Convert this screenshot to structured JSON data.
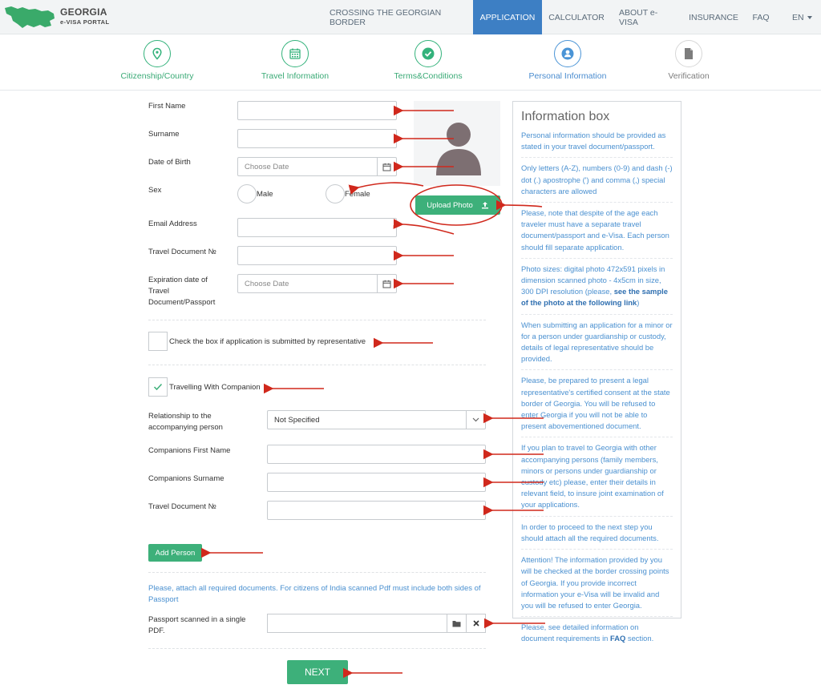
{
  "brand": {
    "title": "GEORGIA",
    "subtitle": "e-VISA PORTAL"
  },
  "nav": {
    "items": [
      {
        "label": "CROSSING THE GEORGIAN BORDER",
        "active": false
      },
      {
        "label": "APPLICATION",
        "active": true
      },
      {
        "label": "CALCULATOR",
        "active": false
      },
      {
        "label": "ABOUT e-VISA",
        "active": false
      },
      {
        "label": "INSURANCE",
        "active": false
      },
      {
        "label": "FAQ",
        "active": false
      }
    ],
    "language": "EN"
  },
  "steps": [
    {
      "label": "Citizenship/Country",
      "icon": "map-pin-icon",
      "state": "done"
    },
    {
      "label": "Travel Information",
      "icon": "calendar-icon",
      "state": "done"
    },
    {
      "label": "Terms&Conditions",
      "icon": "check-icon",
      "state": "done"
    },
    {
      "label": "Personal Information",
      "icon": "user-icon",
      "state": "current"
    },
    {
      "label": "Verification",
      "icon": "document-icon",
      "state": "pending"
    }
  ],
  "form": {
    "first_name_label": "First Name",
    "first_name_value": "",
    "surname_label": "Surname",
    "surname_value": "",
    "dob_label": "Date of Birth",
    "dob_placeholder": "Choose Date",
    "sex_label": "Sex",
    "sex_options": [
      "Male",
      "Female"
    ],
    "email_label": "Email Address",
    "email_value": "",
    "travel_doc_label": "Travel Document №",
    "travel_doc_value": "",
    "expiration_label_1": "Expiration date of",
    "expiration_label_2": "Travel",
    "expiration_label_3": "Document/Passport",
    "expiration_placeholder": "Choose Date",
    "upload_photo_label": "Upload Photo",
    "representative_label": "Check the box if application is submitted by representative",
    "representative_checked": false,
    "companion_label": "Travelling With Companion",
    "companion_checked": true,
    "relationship_label_1": "Relationship to the",
    "relationship_label_2": "accompanying person",
    "relationship_value": "Not Specified",
    "companion_first_name_label": "Companions First Name",
    "companion_surname_label": "Companions Surname",
    "companion_travel_doc_label": "Travel Document №",
    "add_person_label": "Add Person",
    "attach_note": "Please, attach all required documents. For citizens of India scanned Pdf must include both sides of Passport",
    "passport_label_1": "Passport scanned in a single",
    "passport_label_2": "PDF.",
    "next_label": "NEXT"
  },
  "info_box": {
    "title": "Information box",
    "p1": "Personal information should be provided as stated in your travel document/passport.",
    "p2": "Only letters (A-Z), numbers (0-9) and dash (-) dot (.) apostrophe (') and comma (,) special characters are allowed",
    "p3": "Please, note that despite of the age each traveler must have a separate travel document/passport and e-Visa. Each person should fill separate application.",
    "p4_text": "Photo sizes: digital photo 472x591 pixels in dimension scanned photo - 4x5cm in size, 300 DPI resolution (please, ",
    "p4_link": "see the sample of the photo at the following link",
    "p4_end": ")",
    "p5": "When submitting an application for a minor or for a person under guardianship or custody, details of legal representative should be provided.",
    "p6": "Please, be prepared to present a legal representative's certified consent at the state border of Georgia. You will be refused to enter Georgia if you will not be able to present abovementioned document.",
    "p7": "If you plan to travel to Georgia with other accompanying persons (family members, minors or persons under guardianship or custody etc) please, enter their details in relevant field, to insure joint examination of your applications.",
    "p8": "In order to proceed to the next step you should attach all the required documents.",
    "p9": "Attention! The information provided by you will be checked at the border crossing points of Georgia. If you provide incorrect information your e-Visa will be invalid and you will be refused to enter Georgia.",
    "p10_text": "Please, see detailed information on document requirements in ",
    "p10_link": "FAQ",
    "p10_end": " section."
  },
  "colors": {
    "accent_green": "#3db07a",
    "accent_blue": "#3d7fc4",
    "annotation_red": "#d0281c"
  }
}
